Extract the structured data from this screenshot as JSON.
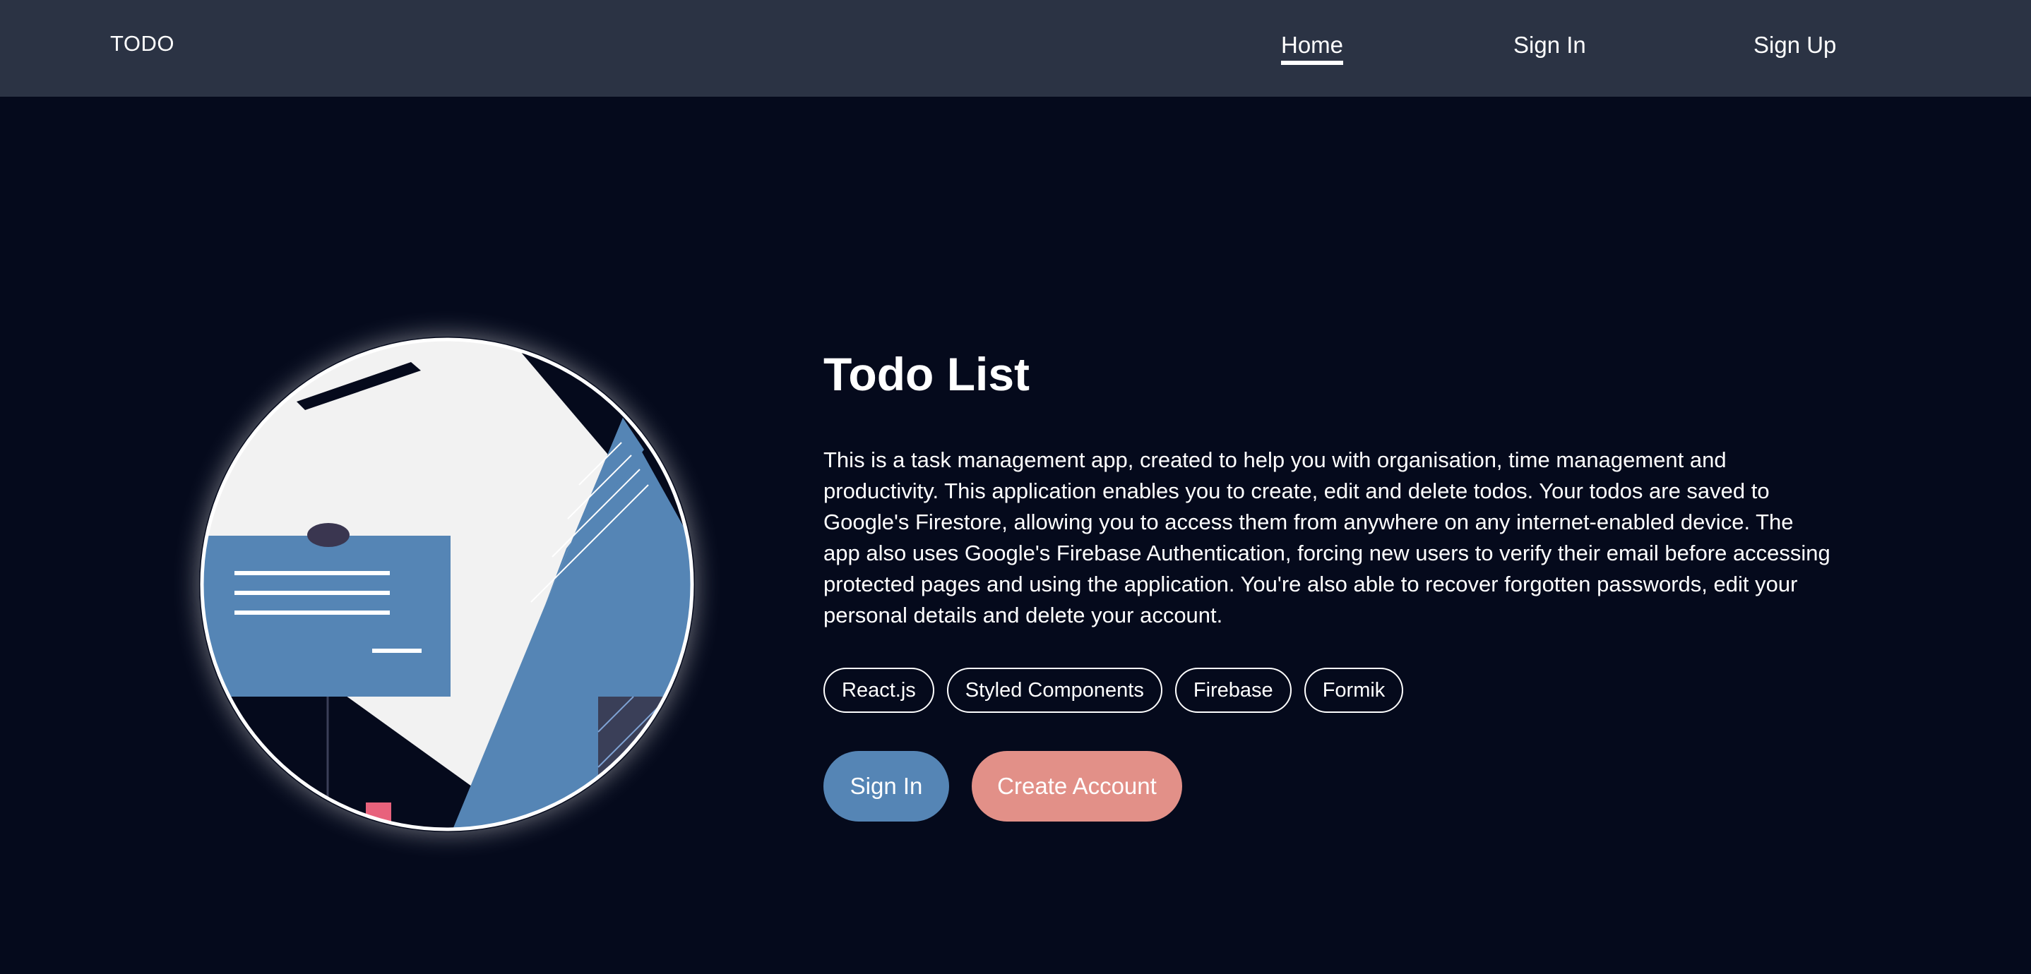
{
  "navbar": {
    "brand": "TODO",
    "links": [
      {
        "label": "Home",
        "active": true
      },
      {
        "label": "Sign In",
        "active": false
      },
      {
        "label": "Sign Up",
        "active": false
      }
    ]
  },
  "hero": {
    "illustration": "task-list-illustration",
    "title": "Todo List",
    "description": "This is a task management app, created to help you with organisation, time management and productivity. This application enables you to create, edit and delete todos. Your todos are saved to Google's Firestore, allowing you to access them from anywhere on any internet-enabled device. The app also uses Google's Firebase Authentication, forcing new users to verify their email before accessing protected pages and using the application. You're also able to recover forgotten passwords, edit your personal details and delete your account.",
    "tags": [
      "React.js",
      "Styled Components",
      "Firebase",
      "Formik"
    ],
    "buttons": {
      "sign_in": "Sign In",
      "create_account": "Create Account"
    }
  },
  "colors": {
    "background": "#050a1c",
    "navbar": "#2b3344",
    "primary": "#5585b5",
    "secondary": "#e29088",
    "text": "#ffffff"
  }
}
